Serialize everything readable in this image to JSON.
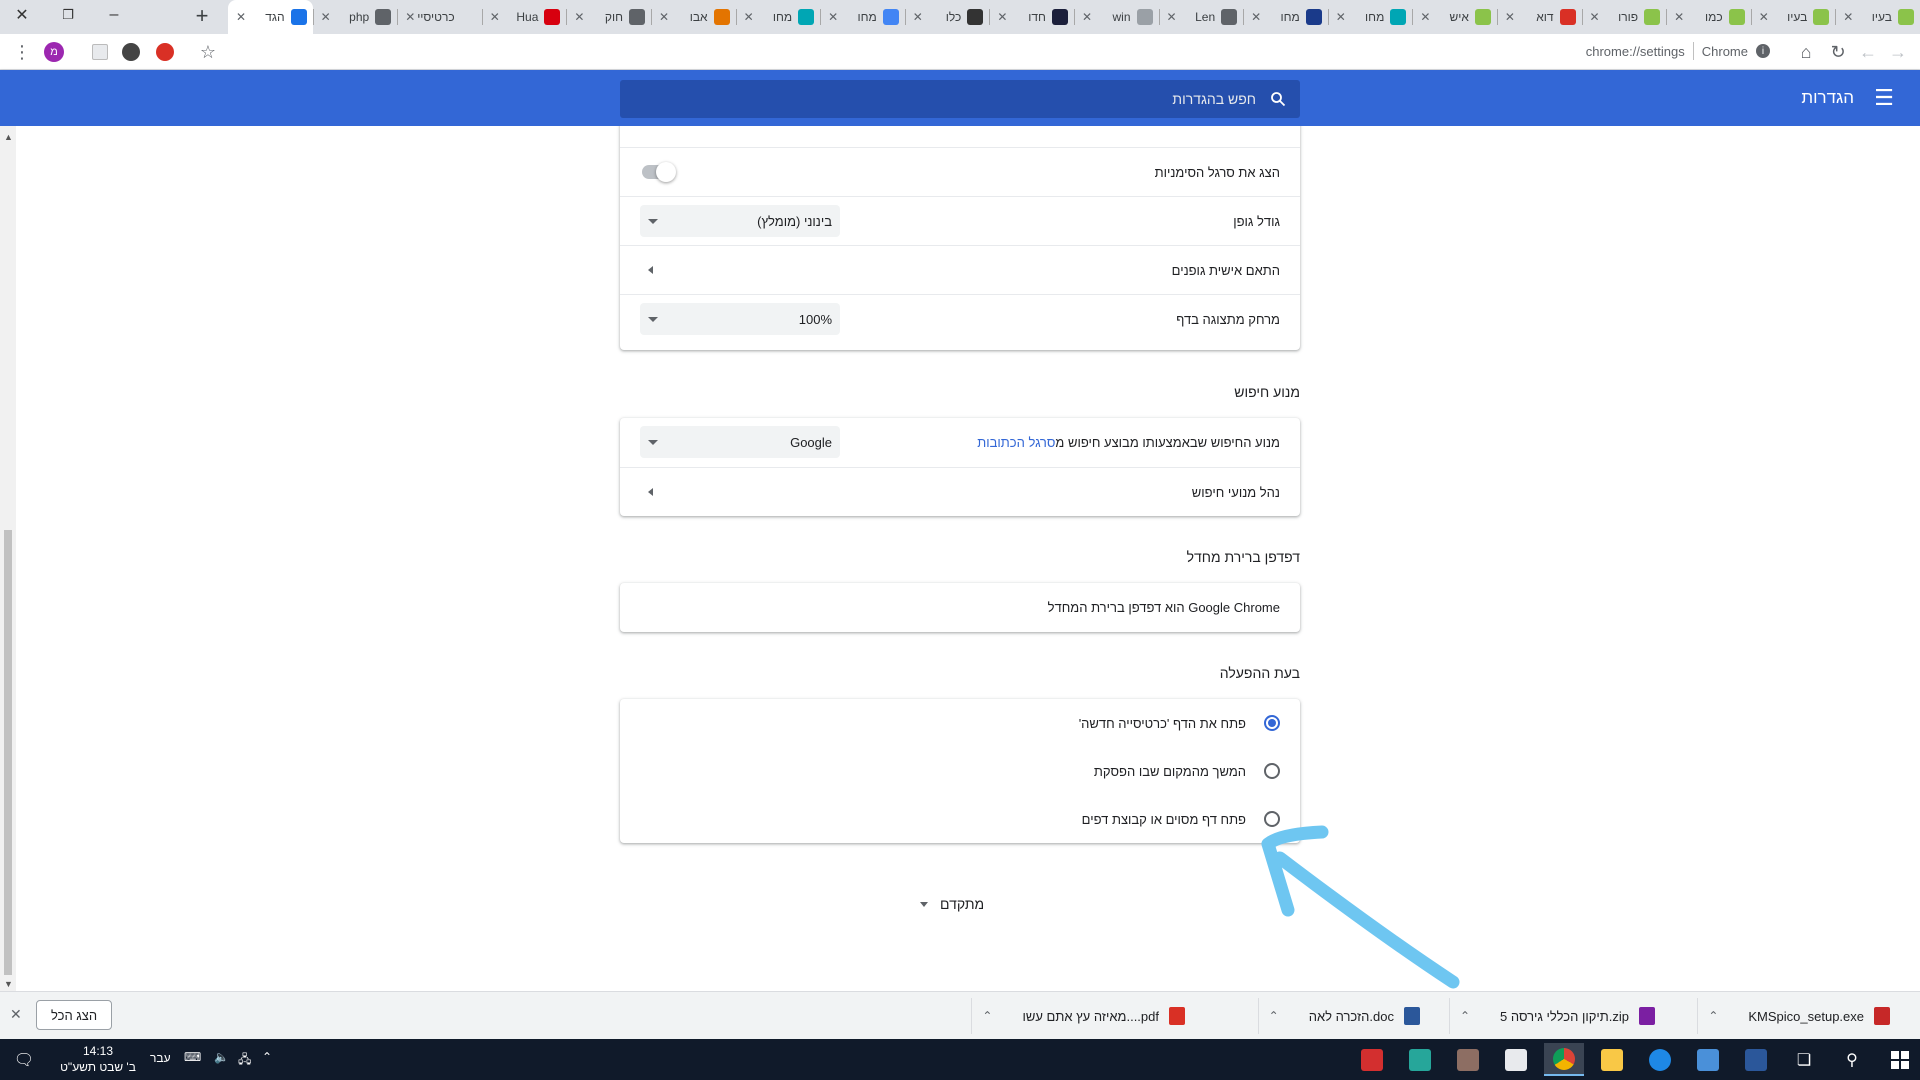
{
  "tabstrip": {
    "new_tab": "+",
    "tabs": [
      {
        "title": "הגד",
        "icon_color": "#1a73e8",
        "active": true
      },
      {
        "title": "php",
        "icon_color": "#5f6368"
      },
      {
        "title": "כרטיסיי",
        "icon_color": "#dee1e6"
      },
      {
        "title": "Hua",
        "icon_color": "#d7000f"
      },
      {
        "title": "חוק",
        "icon_color": "#5f6368"
      },
      {
        "title": "אבו",
        "icon_color": "#e37400"
      },
      {
        "title": "מחו",
        "icon_color": "#00a6b4"
      },
      {
        "title": "מחו",
        "icon_color": "#4285f4"
      },
      {
        "title": "כלו",
        "icon_color": "#333333"
      },
      {
        "title": "חדו",
        "icon_color": "#1b1f3b"
      },
      {
        "title": "win",
        "icon_color": "#9aa0a6"
      },
      {
        "title": "Len",
        "icon_color": "#5f6368"
      },
      {
        "title": "מחו",
        "icon_color": "#1a3a8a"
      },
      {
        "title": "מחו",
        "icon_color": "#00a6b4"
      },
      {
        "title": "איש",
        "icon_color": "#8bc34a"
      },
      {
        "title": "דוא",
        "icon_color": "#d93025"
      },
      {
        "title": "פורו",
        "icon_color": "#8bc34a"
      },
      {
        "title": "כמו",
        "icon_color": "#8bc34a"
      },
      {
        "title": "בעיו",
        "icon_color": "#8bc34a"
      },
      {
        "title": "בעיו",
        "icon_color": "#8bc34a"
      }
    ]
  },
  "toolbar": {
    "url": "chrome://settings",
    "site_label": "Chrome",
    "profile_initial": "מ"
  },
  "header": {
    "title": "הגדרות",
    "search_placeholder": "חפש בהגדרות"
  },
  "appearance": {
    "bookmarks_bar_label": "הצג את סרגל הסימניות",
    "bookmarks_bar_on": false,
    "font_size_label": "גודל גופן",
    "font_size_value": "בינוני (מומלץ)",
    "customize_fonts_label": "התאם אישית גופנים",
    "page_zoom_label": "מרחק מתצוגה בדף",
    "page_zoom_value": "100%"
  },
  "search_engine": {
    "section_title": "מנוע חיפוש",
    "engine_label_prefix": "מנוע החיפוש שבאמצעותו מבוצע חיפוש מ",
    "engine_label_link": "סרגל הכתובות",
    "engine_value": "Google",
    "manage_label": "נהל מנועי חיפוש"
  },
  "default_browser": {
    "section_title": "דפדפן ברירת מחדל",
    "status": "Google Chrome הוא דפדפן ברירת המחדל"
  },
  "on_startup": {
    "section_title": "בעת ההפעלה",
    "options": [
      {
        "label": "פתח את הדף 'כרטיסייה חדשה'",
        "checked": true
      },
      {
        "label": "המשך מהמקום שבו הפסקת",
        "checked": false
      },
      {
        "label": "פתח דף מסוים או קבוצת דפים",
        "checked": false
      }
    ]
  },
  "advanced_label": "מתקדם",
  "annotation_color": "#6ec6f1",
  "downloads": {
    "items": [
      {
        "name": "KMSpico_setup.exe",
        "icon_color": "#c62828"
      },
      {
        "name": "תיקון הכללי גירסה 5.zip",
        "icon_color": "#7b1fa2"
      },
      {
        "name": "הזכרה לאה.doc",
        "icon_color": "#2b579a"
      },
      {
        "name": "מאיזה עץ אתם עשו....pdf",
        "icon_color": "#d93025"
      }
    ],
    "show_all": "הצג הכל"
  },
  "taskbar": {
    "time": "14:13",
    "date": "ב' שבט תשע\"ט",
    "language": "עבר"
  }
}
